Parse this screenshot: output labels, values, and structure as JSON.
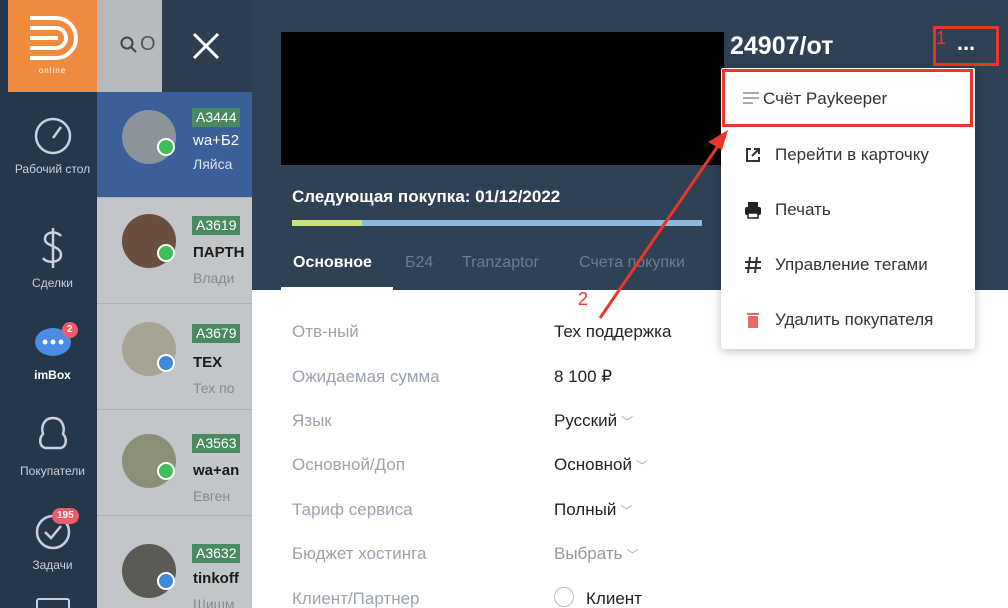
{
  "sidebar": {
    "logo_text": "online",
    "items": [
      {
        "label": "Рабочий стол",
        "icon": "dashboard-gauge-icon"
      },
      {
        "label": "Сделки",
        "icon": "dollar-icon"
      },
      {
        "label": "imBox",
        "icon": "chat-bubble-icon",
        "badge": "2"
      },
      {
        "label": "Покупатели",
        "icon": "customers-icon"
      },
      {
        "label": "Задачи",
        "icon": "tasks-check-icon",
        "badge": "195"
      }
    ]
  },
  "search": {
    "text": "О"
  },
  "chats": [
    {
      "tag": "A3444",
      "name": "wa+Б2",
      "sub": "Ляйса",
      "messenger": "whatsapp"
    },
    {
      "tag": "A3619",
      "name": "ПАРТН",
      "sub": "Влади",
      "messenger": "whatsapp"
    },
    {
      "tag": "A3679",
      "name": "ТЕХ",
      "sub": "Тех по",
      "messenger": "telegram"
    },
    {
      "tag": "A3563",
      "name": "wa+an",
      "sub": "Евген",
      "messenger": "whatsapp"
    },
    {
      "tag": "A3632",
      "name": "tinkoff",
      "sub": "Шишм",
      "messenger": "telegram"
    }
  ],
  "customer": {
    "title": "24907/от",
    "more_label": "...",
    "next_purchase": "Следующая покупка: 01/12/2022",
    "progress_fraction": 0.17,
    "tabs": [
      "Основное",
      "Б24",
      "Tranzaptor",
      "Счета покупки"
    ],
    "fields": [
      {
        "label": "Отв-ный",
        "value": "Тех поддержка"
      },
      {
        "label": "Ожидаемая сумма",
        "value": "8 100 ₽"
      },
      {
        "label": "Язык",
        "value": "Русский"
      },
      {
        "label": "Основной/Доп",
        "value": "Основной"
      },
      {
        "label": "Тариф сервиса",
        "value": "Полный"
      },
      {
        "label": "Бюджет хостинга",
        "value": "Выбрать"
      },
      {
        "label": "Клиент/Партнер",
        "value": "Клиент"
      }
    ]
  },
  "menu": {
    "items": [
      {
        "label": "Счёт Paykeeper",
        "icon": "invoice-lines-icon"
      },
      {
        "label": "Перейти в карточку",
        "icon": "external-link-icon"
      },
      {
        "label": "Печать",
        "icon": "printer-icon"
      },
      {
        "label": "Управление тегами",
        "icon": "hashtag-icon"
      },
      {
        "label": "Удалить покупателя",
        "icon": "trash-icon"
      }
    ]
  },
  "annotations": {
    "step1": "1",
    "step2": "2",
    "color": "#e8362a"
  }
}
